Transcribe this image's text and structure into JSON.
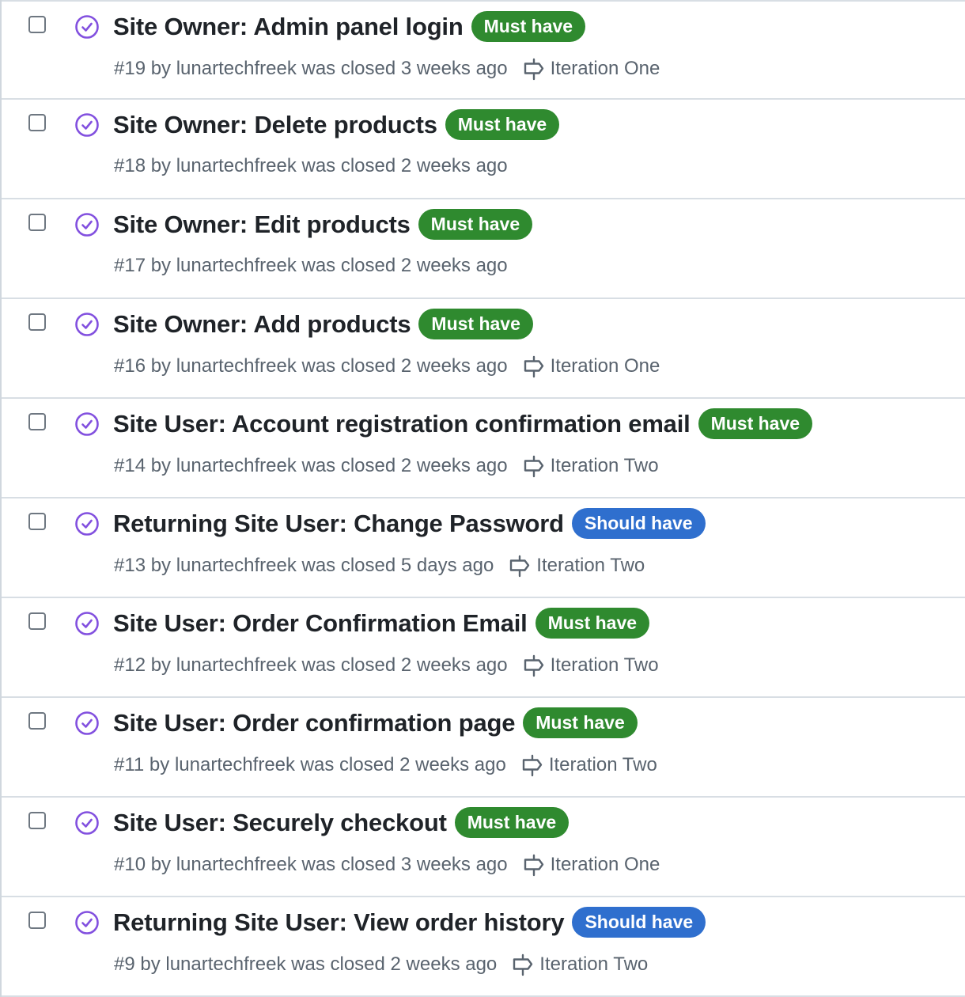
{
  "colors": {
    "must_have": "#2f8a2f",
    "should_have": "#2f6fce",
    "closed_icon": "#8250df",
    "meta_text": "#59636e",
    "title_text": "#1f2328"
  },
  "issues": [
    {
      "title": "Site Owner: Admin panel login",
      "label": "Must have",
      "label_kind": "must_have",
      "meta": "#19 by lunartechfreek was closed 3 weeks ago",
      "milestone": "Iteration One",
      "icon": "check-circle-icon"
    },
    {
      "title": "Site Owner: Delete products",
      "label": "Must have",
      "label_kind": "must_have",
      "meta": "#18 by lunartechfreek was closed 2 weeks ago",
      "milestone": null,
      "icon": "check-circle-icon"
    },
    {
      "title": "Site Owner: Edit products",
      "label": "Must have",
      "label_kind": "must_have",
      "meta": "#17 by lunartechfreek was closed 2 weeks ago",
      "milestone": null,
      "icon": "check-circle-icon"
    },
    {
      "title": "Site Owner: Add products",
      "label": "Must have",
      "label_kind": "must_have",
      "meta": "#16 by lunartechfreek was closed 2 weeks ago",
      "milestone": "Iteration One",
      "icon": "check-circle-icon"
    },
    {
      "title": "Site User: Account registration confirmation email",
      "label": "Must have",
      "label_kind": "must_have",
      "meta": "#14 by lunartechfreek was closed 2 weeks ago",
      "milestone": "Iteration Two",
      "icon": "check-circle-icon"
    },
    {
      "title": "Returning Site User: Change Password",
      "label": "Should have",
      "label_kind": "should_have",
      "meta": "#13 by lunartechfreek was closed 5 days ago",
      "milestone": "Iteration Two",
      "icon": "check-circle-icon"
    },
    {
      "title": "Site User: Order Confirmation Email",
      "label": "Must have",
      "label_kind": "must_have",
      "meta": "#12 by lunartechfreek was closed 2 weeks ago",
      "milestone": "Iteration Two",
      "icon": "check-circle-icon"
    },
    {
      "title": "Site User: Order confirmation page",
      "label": "Must have",
      "label_kind": "must_have",
      "meta": "#11 by lunartechfreek was closed 2 weeks ago",
      "milestone": "Iteration Two",
      "icon": "check-circle-icon"
    },
    {
      "title": "Site User: Securely checkout",
      "label": "Must have",
      "label_kind": "must_have",
      "meta": "#10 by lunartechfreek was closed 3 weeks ago",
      "milestone": "Iteration One",
      "icon": "check-circle-icon"
    },
    {
      "title": "Returning Site User: View order history",
      "label": "Should have",
      "label_kind": "should_have",
      "meta": "#9 by lunartechfreek was closed 2 weeks ago",
      "milestone": "Iteration Two",
      "icon": "check-circle-icon"
    }
  ]
}
